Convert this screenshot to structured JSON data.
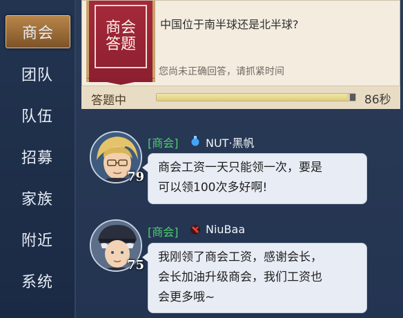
{
  "sidebar": {
    "items": [
      {
        "label": "商会",
        "active": true
      },
      {
        "label": "团队",
        "active": false
      },
      {
        "label": "队伍",
        "active": false
      },
      {
        "label": "招募",
        "active": false
      },
      {
        "label": "家族",
        "active": false
      },
      {
        "label": "附近",
        "active": false
      },
      {
        "label": "系统",
        "active": false
      }
    ]
  },
  "quiz": {
    "badge_line1": "商会",
    "badge_line2": "答题",
    "question": "中国位于南半球还是北半球?",
    "hint": "您尚未正确回答，请抓紧时间",
    "status": "答题中",
    "timer": "86秒",
    "progress_percent": 96
  },
  "messages": [
    {
      "tag": "[商会]",
      "icon": "blue-potion-icon",
      "name": "NUT·黑帆",
      "level": "79",
      "lines": [
        "商会工资一天只能领一次，要是",
        "可以领100次多好啊!"
      ]
    },
    {
      "tag": "[商会]",
      "icon": "red-blade-icon",
      "name": "NiuBaa",
      "level": "75",
      "lines": [
        "我刚领了商会工资，感谢会长，",
        "会长加油升级商会，我们工资也",
        "会更多哦~"
      ]
    }
  ],
  "colors": {
    "accent_gold": "#b9864a",
    "tag_green": "#4fcf72",
    "badge_red": "#a52a3b"
  }
}
